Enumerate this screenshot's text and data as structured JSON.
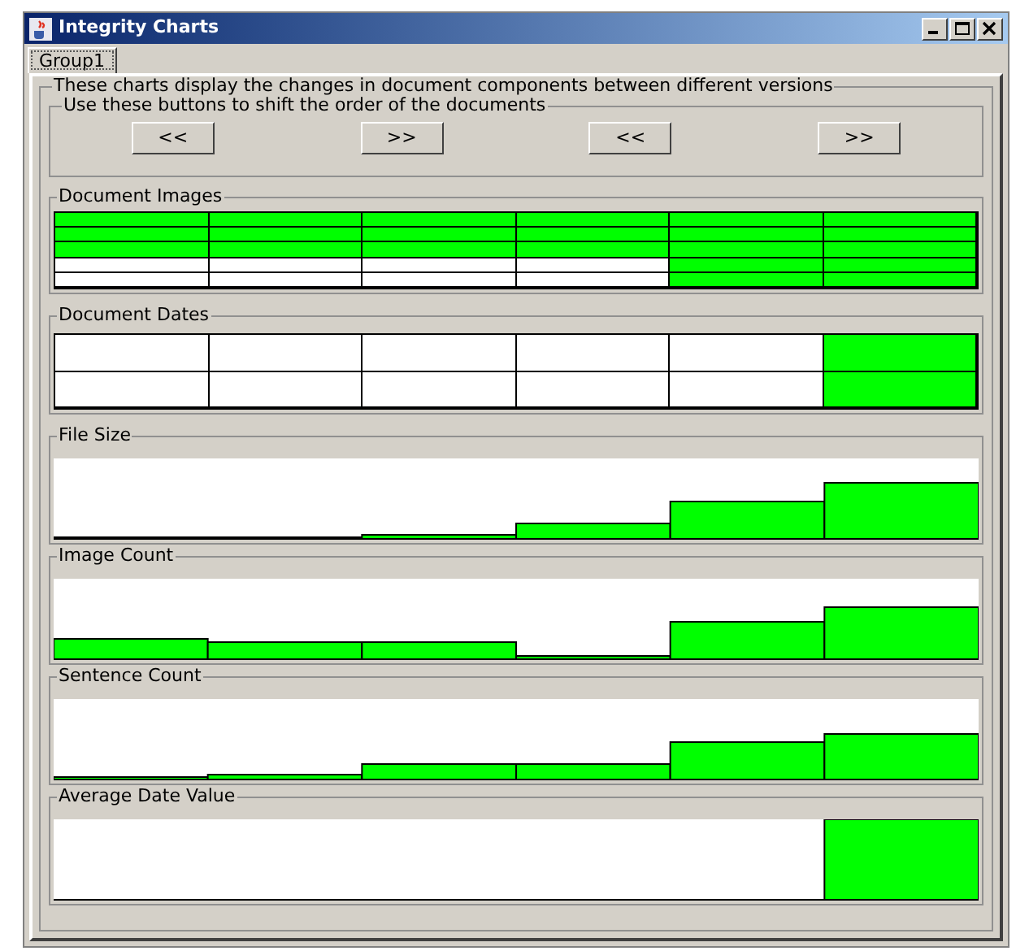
{
  "window": {
    "title": "Integrity Charts"
  },
  "tabs": [
    {
      "label": "Group1",
      "selected": true
    }
  ],
  "description": "These charts display the changes in document components between different versions",
  "navigation": {
    "title": "Use these buttons to shift the order of the documents",
    "buttons": [
      "<<",
      ">>",
      "<<",
      ">>"
    ]
  },
  "grids": [
    {
      "title": "Document Images",
      "rows": [
        [
          {
            "filled": true
          },
          {
            "filled": true
          },
          {
            "filled": true
          },
          {
            "filled": true
          },
          {
            "filled": true
          },
          {
            "filled": true
          }
        ],
        [
          {
            "filled": true
          },
          {
            "filled": true
          },
          {
            "filled": true
          },
          {
            "filled": true
          },
          {
            "filled": true
          },
          {
            "filled": true
          }
        ],
        [
          {
            "filled": true
          },
          {
            "filled": true
          },
          {
            "filled": true
          },
          {
            "filled": true
          },
          {
            "filled": true
          },
          {
            "filled": true
          }
        ],
        [
          {
            "filled": false
          },
          {
            "filled": false
          },
          {
            "filled": false
          },
          {
            "filled": false
          },
          {
            "filled": true
          },
          {
            "filled": true
          }
        ],
        [
          {
            "filled": false
          },
          {
            "filled": false
          },
          {
            "filled": false
          },
          {
            "filled": false
          },
          {
            "filled": true
          },
          {
            "filled": true
          }
        ]
      ]
    },
    {
      "title": "Document Dates",
      "rows": [
        [
          {
            "filled": false
          },
          {
            "filled": false
          },
          {
            "filled": false
          },
          {
            "filled": false
          },
          {
            "filled": false
          },
          {
            "filled": true
          }
        ],
        [
          {
            "filled": false
          },
          {
            "filled": false
          },
          {
            "filled": false
          },
          {
            "filled": false
          },
          {
            "filled": false
          },
          {
            "filled": true
          }
        ]
      ]
    }
  ],
  "bar_panels": [
    {
      "title": "File Size"
    },
    {
      "title": "Image Count"
    },
    {
      "title": "Sentence Count"
    },
    {
      "title": "Average Date Value"
    }
  ]
}
